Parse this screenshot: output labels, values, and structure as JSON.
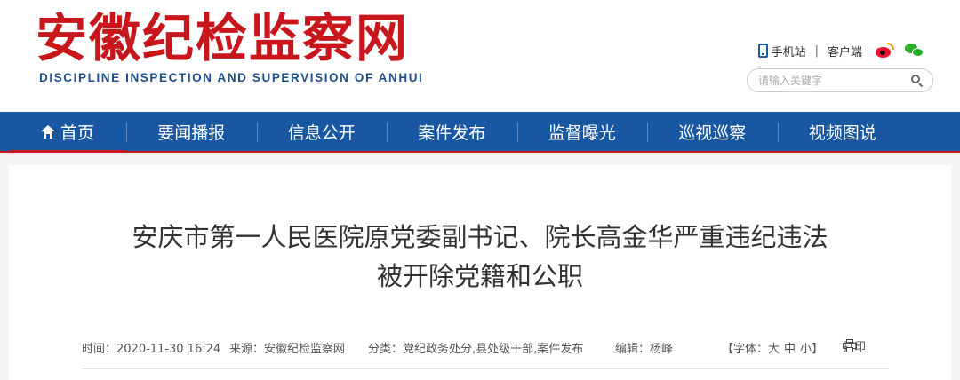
{
  "header": {
    "logo_cn": "安徽纪检监察网",
    "logo_en": "DISCIPLINE INSPECTION AND SUPERVISION OF ANHUI",
    "links": {
      "mobile": "手机站",
      "separator": "|",
      "client": "客户端"
    },
    "search": {
      "placeholder": "请输入关键字"
    },
    "icons": {
      "mobile": "phone-icon",
      "weibo": "weibo-icon",
      "wechat": "wechat-icon",
      "search": "search-icon"
    }
  },
  "nav": {
    "items": [
      {
        "label": "首页",
        "icon": "home-icon",
        "active": true
      },
      {
        "label": "要闻播报"
      },
      {
        "label": "信息公开"
      },
      {
        "label": "案件发布"
      },
      {
        "label": "监督曝光"
      },
      {
        "label": "巡视巡察"
      },
      {
        "label": "视频图说"
      }
    ]
  },
  "article": {
    "title_line1": "安庆市第一人民医院原党委副书记、院长高金华严重违纪违法",
    "title_line2": "被开除党籍和公职",
    "meta": {
      "time": "时间：2020-11-30 16:24",
      "source": "来源：安徽纪检监察网",
      "category": "分类：党纪政务处分,县处级干部,案件发布",
      "editor": "编辑：杨峰",
      "font_prefix": "【字体：",
      "font_large": "大",
      "font_medium": "中",
      "font_small": "小",
      "font_suffix": "】",
      "print": "打印"
    }
  },
  "colors": {
    "brand_red": "#c8161d",
    "nav_blue": "#1858a2",
    "logo_en_blue": "#1d4f8c"
  }
}
